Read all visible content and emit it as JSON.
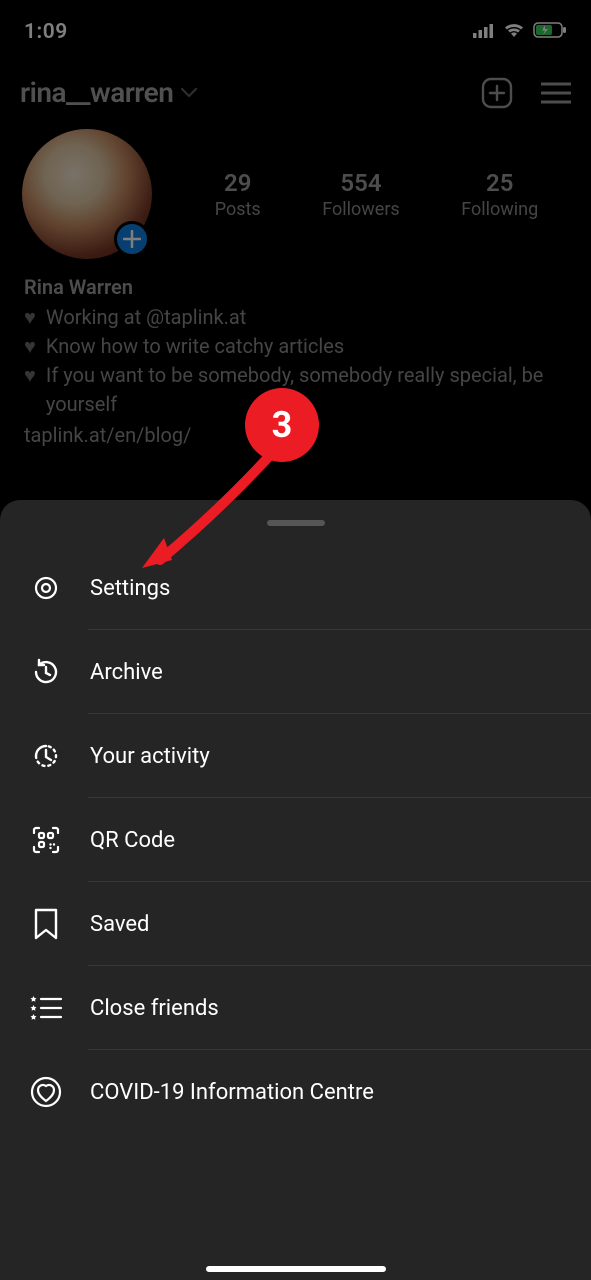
{
  "status": {
    "time": "1:09"
  },
  "header": {
    "username": "rina__warren"
  },
  "profile": {
    "stats": {
      "posts_num": "29",
      "posts_label": "Posts",
      "followers_num": "554",
      "followers_label": "Followers",
      "following_num": "25",
      "following_label": "Following"
    },
    "display_name": "Rina Warren",
    "bio_line1": "Working at @taplink.at",
    "bio_line2": "Know how to write catchy articles",
    "bio_line3": "If you want to be somebody, somebody really special, be yourself",
    "link": "taplink.at/en/blog/"
  },
  "menu": {
    "items": [
      {
        "icon": "settings-icon",
        "label": "Settings"
      },
      {
        "icon": "archive-icon",
        "label": "Archive"
      },
      {
        "icon": "activity-icon",
        "label": "Your activity"
      },
      {
        "icon": "qr-icon",
        "label": "QR Code"
      },
      {
        "icon": "saved-icon",
        "label": "Saved"
      },
      {
        "icon": "close-friends-icon",
        "label": "Close friends"
      },
      {
        "icon": "covid-icon",
        "label": "COVID-19 Information Centre"
      }
    ]
  },
  "annotation": {
    "step": "3"
  }
}
